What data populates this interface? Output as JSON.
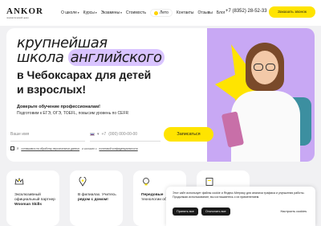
{
  "header": {
    "logo": "ANKOR",
    "logo_subtitle": "лингвистический центр",
    "nav": [
      {
        "label": "О школе",
        "chevron": true
      },
      {
        "label": "Курсы",
        "chevron": true
      },
      {
        "label": "Экзамены",
        "chevron": true
      },
      {
        "label": "Стоимость",
        "chevron": false
      },
      {
        "label": "Лето",
        "chevron": false,
        "badge": true
      },
      {
        "label": "Контакты",
        "chevron": false
      },
      {
        "label": "Отзывы",
        "chevron": false
      },
      {
        "label": "Блог",
        "chevron": false
      }
    ],
    "phone": "+7 (8352) 28-52-33",
    "callback_label": "Заказать звонок"
  },
  "hero": {
    "title_line1": "крупнейшая",
    "title_line2_a": "школа",
    "title_line2_b": "английского",
    "title_line3": "в Чебоксарах для детей",
    "title_line4": "и взрослых!",
    "subtitle1": "Доверьте обучение профессионалам!",
    "subtitle2": "Подготовим к ЕГЭ, ОГЭ, TOEFL, повысим уровень по CEFR"
  },
  "form": {
    "name_placeholder": "Ваше имя",
    "phone_prefix": "+7",
    "phone_placeholder": "(000) 000-00-00",
    "submit_label": "Записаться"
  },
  "consent": {
    "prefix": "Я",
    "link1": "соглашаюсь на обработку персональных данных",
    "middle": "и согласен с",
    "link2": "политикой конфиденциальности"
  },
  "cards": [
    {
      "text": "Эксклюзивный официальный партнер",
      "bold": "Wooman Skills"
    },
    {
      "text": "В филиалах. Учитесь",
      "bold": "рядом с домом!"
    },
    {
      "text": "",
      "bold": "Передовые",
      "text2": "технологии обучения"
    },
    {
      "text": "",
      "bold": ""
    }
  ],
  "cookie": {
    "text": "Этот сайт использует файлы cookie и Яндекс.Метрику для анализа трафика и улучшения работы. Продолжая использование, вы соглашаетесь с их применением.",
    "accept_all": "Принять все",
    "reject_all": "Отклонить все",
    "settings": "Настроить cookies"
  },
  "colors": {
    "accent": "#ffe400",
    "hero_purple": "#c8a8f4",
    "highlight": "#d9c4ff"
  }
}
